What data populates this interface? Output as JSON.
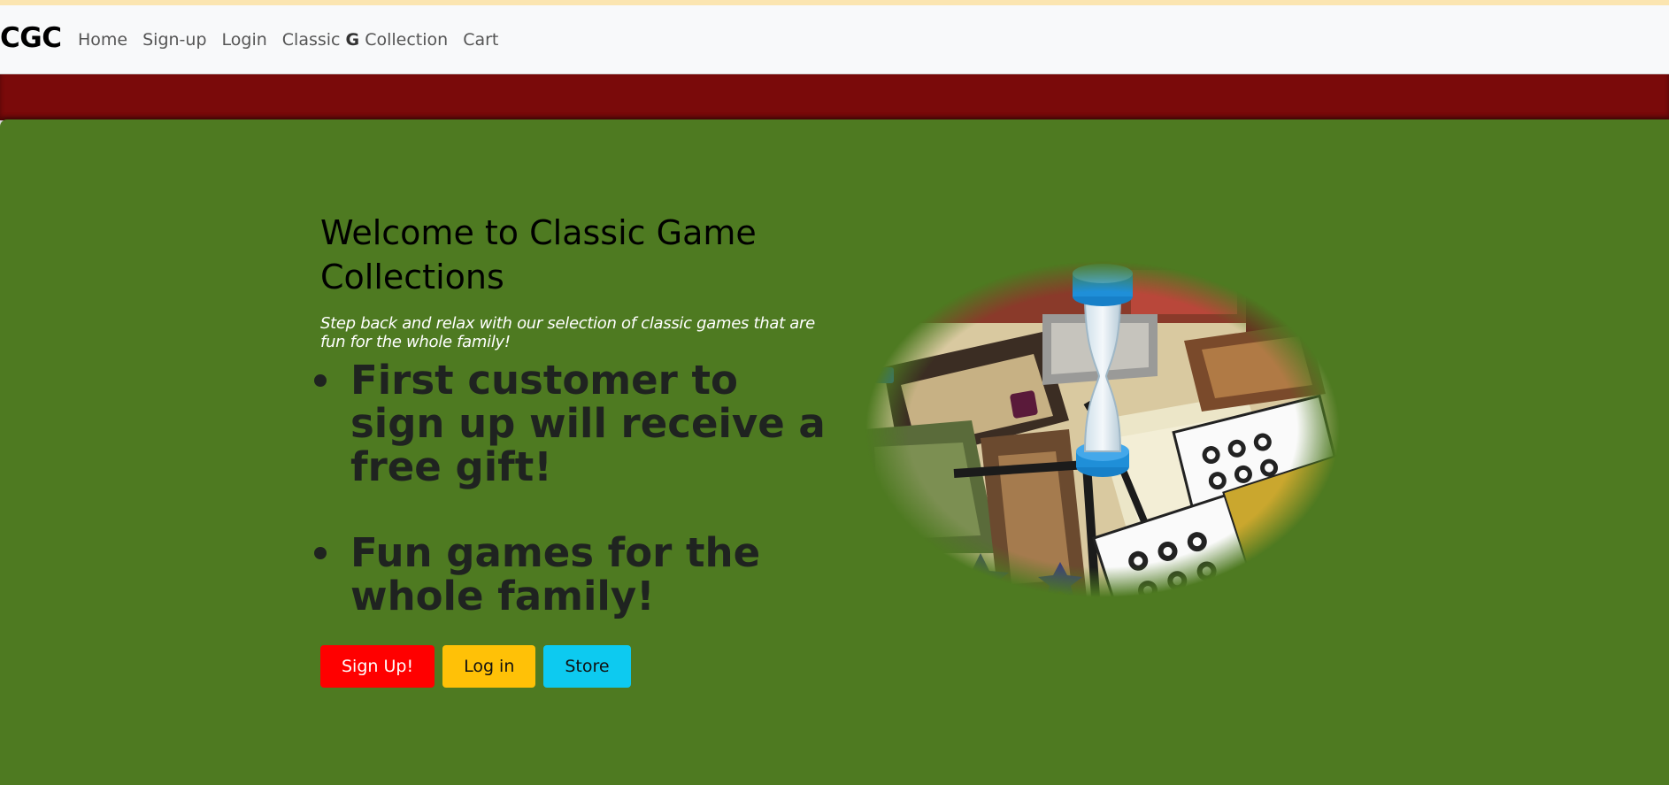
{
  "navbar": {
    "brand": "CGC",
    "links": {
      "home": "Home",
      "signup": "Sign-up",
      "login": "Login",
      "collection_pre": "Classic ",
      "collection_bold": "G",
      "collection_post": " Collection",
      "cart": "Cart"
    }
  },
  "hero": {
    "title": "Welcome to Classic Game Collections",
    "subtitle": "Step back and relax with our selection of classic games that are fun for the whole family!",
    "features": [
      "First customer to sign up will receive a free gift!",
      "Fun games for the whole family!"
    ],
    "buttons": {
      "signup": "Sign Up!",
      "login": "Log in",
      "store": "Store"
    },
    "image_subject": "board-game-with-hourglass-photo"
  },
  "colors": {
    "red_band": "#7a0a0a",
    "hero_bg": "#4e7a21",
    "signup_btn": "#ff0000",
    "login_btn": "#ffc107",
    "store_btn": "#0dcaf0"
  }
}
